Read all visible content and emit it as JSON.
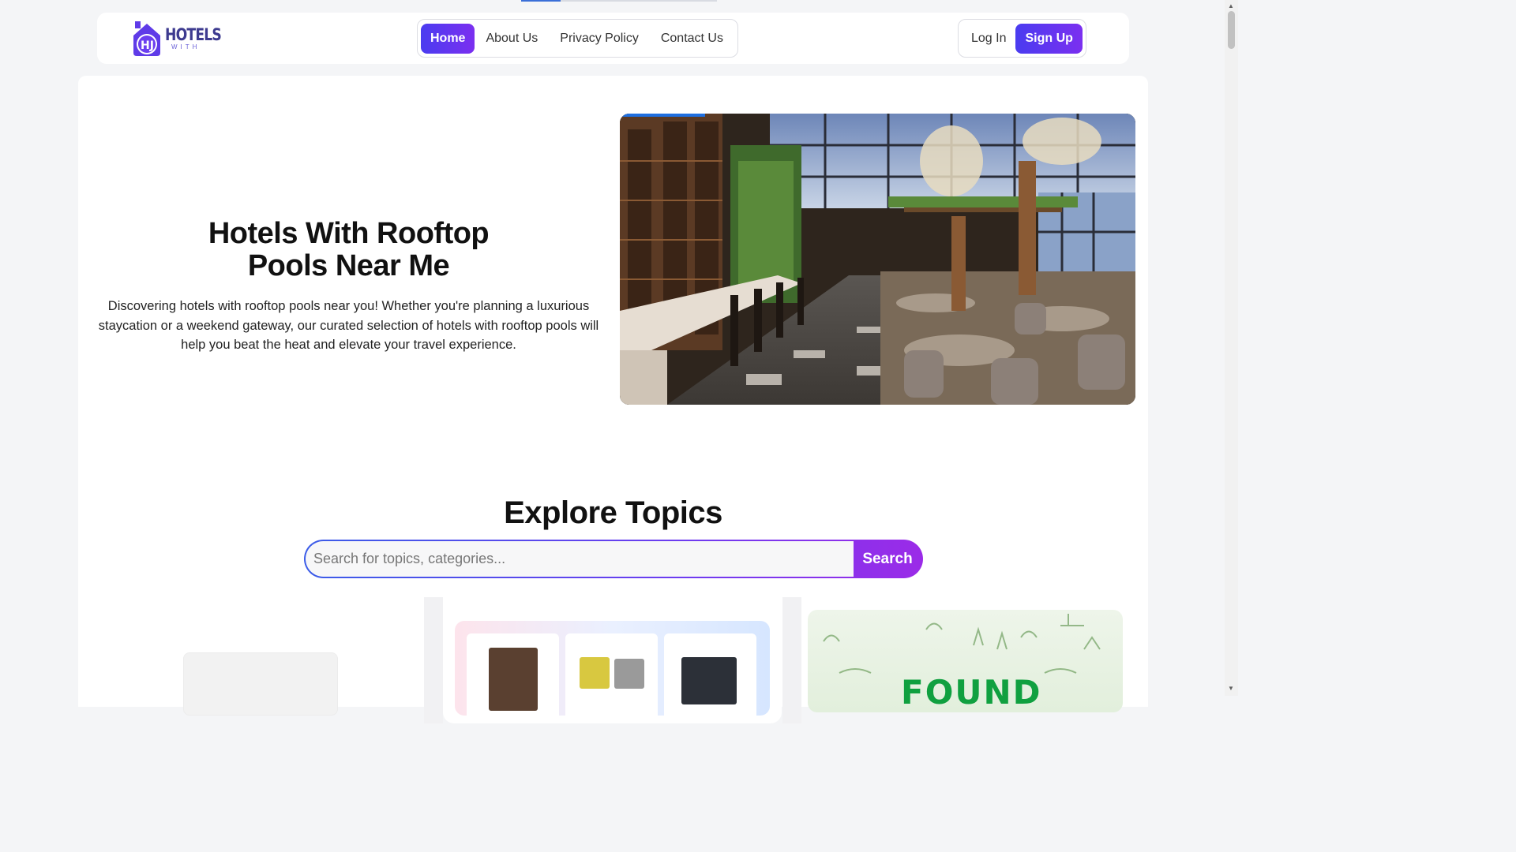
{
  "brand": {
    "logo_text": "HOTELS",
    "logo_subtext": "WITH"
  },
  "nav": {
    "items": [
      {
        "label": "Home",
        "active": true
      },
      {
        "label": "About Us",
        "active": false
      },
      {
        "label": "Privacy Policy",
        "active": false
      },
      {
        "label": "Contact Us",
        "active": false
      }
    ]
  },
  "auth": {
    "login_label": "Log In",
    "signup_label": "Sign Up"
  },
  "hero": {
    "title": "Hotels With Rooftop Pools Near Me",
    "description": "Discovering hotels with rooftop pools near you! Whether you're planning a luxurious staycation or a weekend gateway, our curated selection of hotels with rooftop pools will help you beat the heat and elevate your travel experience.",
    "image_alt": "hotel-restaurant-interior-image"
  },
  "explore": {
    "title": "Explore Topics",
    "search_placeholder": "Search for topics, categories...",
    "search_button": "Search"
  },
  "cards": {
    "right_card_text": "FOUND"
  },
  "colors": {
    "accent_start": "#4a3cf0",
    "accent_end": "#7b2ff0",
    "page_bg": "#f4f5f7"
  }
}
